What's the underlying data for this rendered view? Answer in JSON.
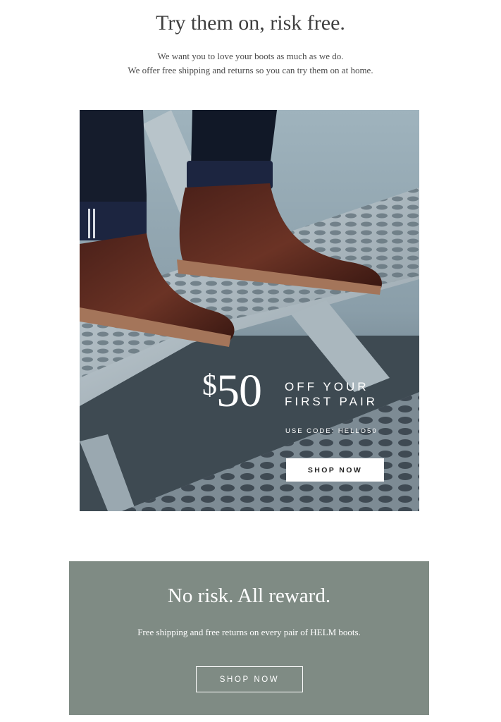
{
  "header": {
    "title": "Try them on, risk free.",
    "intro_line1": "We want you to love your boots as much as we do.",
    "intro_line2": "We offer free shipping and returns so you can try them on at home."
  },
  "promo": {
    "currency": "$",
    "amount": "50",
    "line1": "OFF YOUR",
    "line2": "FIRST PAIR",
    "code_text": "USE CODE: HELLO50",
    "button_label": "SHOP NOW"
  },
  "panel": {
    "title": "No risk. All reward.",
    "subtitle": "Free shipping and free returns on every pair of HELM boots.",
    "button_label": "SHOP NOW"
  },
  "colors": {
    "panel_bg": "#7f8b84",
    "text_dark": "#3f3f3f",
    "white": "#ffffff"
  }
}
